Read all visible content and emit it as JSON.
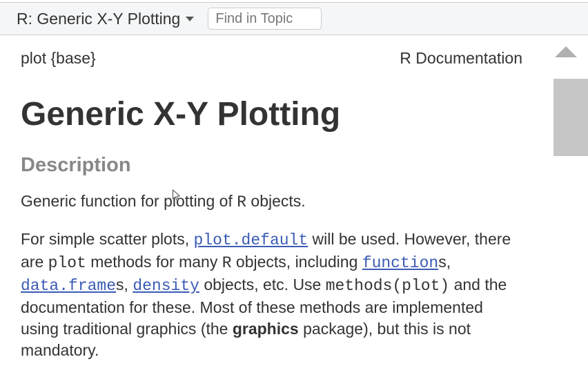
{
  "toolbar": {
    "title": "R: Generic X-Y Plotting",
    "find_placeholder": "Find in Topic"
  },
  "header": {
    "left": "plot {base}",
    "right": "R Documentation"
  },
  "page_title": "Generic X-Y Plotting",
  "sections": {
    "description_heading": "Description"
  },
  "para1": {
    "t1": "Generic function for plotting of ",
    "c1": "R",
    "t2": " objects."
  },
  "para2": {
    "t1": "For simple scatter plots, ",
    "link1": "plot.default",
    "t2": " will be used. However, there are ",
    "c1": "plot",
    "t3": " methods for many ",
    "c2": "R",
    "t4": " objects, including ",
    "link2": "function",
    "t5": "s, ",
    "link3": "data.frame",
    "t6": "s, ",
    "link4": "density",
    "t7": " objects, etc. Use ",
    "c3": "methods(plot)",
    "t8": " and the documentation for these. Most of these methods are implemented using traditional graphics (the ",
    "b1": "graphics",
    "t9": " package), but this is not mandatory."
  }
}
